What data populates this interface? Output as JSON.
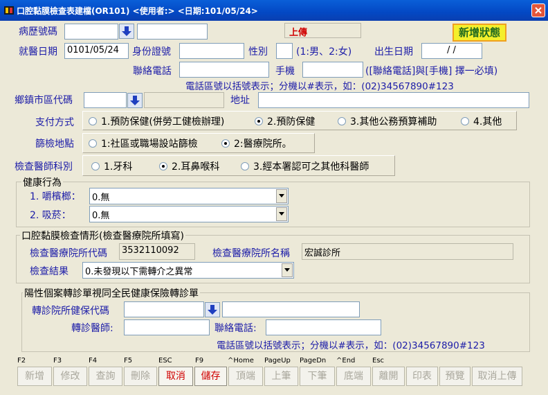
{
  "title": "口腔黏膜檢查表建檔(OR101)  <使用者:>  <日期:101/05/24>",
  "colors": {
    "title_bar": "#0348c4",
    "label": "#1c1ca8",
    "upload_red": "#d00000",
    "new_status_bg": "#f4ef2c"
  },
  "header": {
    "chart_no_label": "病歷號碼",
    "chart_no_value": "",
    "name_value": "",
    "upload_label": "上傳",
    "new_status_button": "新增狀態",
    "visit_date_label": "就醫日期",
    "visit_date_value": "0101/05/24",
    "id_label": "身份證號",
    "id_value": "",
    "gender_label": "性別",
    "gender_value": "",
    "gender_hint": "(1:男、2:女)",
    "birth_label": "出生日期",
    "birth_value": "/    /",
    "phone_label": "聯絡電話",
    "phone_value": "",
    "mobile_label": "手機",
    "mobile_value": "",
    "phone_hint": "([聯絡電話]與[手機] 擇一必填)",
    "phone_format_hint": "電話區號以括號表示；分機以#表示，如：(02)34567890#123",
    "town_code_label": "鄉鎮市區代碼",
    "town_code_value": "",
    "town_name_value": "",
    "address_label": "地址",
    "address_value": ""
  },
  "payment": {
    "label": "支付方式",
    "options": [
      "1.預防保健(併勞工健檢辦理)",
      "2.預防保健",
      "3.其他公務預算補助",
      "4.其他"
    ],
    "selected": "2.預防保健"
  },
  "screening_site": {
    "label": "篩檢地點",
    "options": [
      "1:社區或職場設站篩檢",
      "2:醫療院所。"
    ],
    "selected": "2:醫療院所。"
  },
  "specialty": {
    "label": "檢查醫師科別",
    "options": [
      "1.牙科",
      "2.耳鼻喉科",
      "3.經本署認可之其他科醫師"
    ],
    "selected": "2.耳鼻喉科"
  },
  "health": {
    "title": "健康行為",
    "betel_label": "1. 嚼檳榔：",
    "betel_value": "0.無",
    "smoking_label": "2. 吸菸：",
    "smoking_value": "0.無"
  },
  "exam": {
    "title": "口腔黏膜檢查情形(檢查醫療院所填寫)",
    "hosp_code_label": "檢查醫療院所代碼",
    "hosp_code_value": "3532110092",
    "hosp_name_label": "檢查醫療院所名稱",
    "hosp_name_value": "宏誠診所",
    "result_label": "檢查結果",
    "result_value": "0.未發現以下需轉介之異常"
  },
  "referral": {
    "title": "陽性個案轉診單視同全民健康保險轉診單",
    "hosp_code_label": "轉診院所健保代碼",
    "hosp_code_value": "",
    "hosp_name_value": "",
    "doctor_label": "轉診醫師:",
    "doctor_value": "",
    "phone_label": "聯絡電話:",
    "phone_value": "",
    "phone_format_hint": "電話區號以括號表示；分機以#表示，如：(02)34567890#123"
  },
  "toolbar": [
    {
      "key": "F2",
      "label": "新增",
      "active": false
    },
    {
      "key": "F3",
      "label": "修改",
      "active": false
    },
    {
      "key": "F4",
      "label": "查詢",
      "active": false
    },
    {
      "key": "F5",
      "label": "刪除",
      "active": false
    },
    {
      "key": "ESC",
      "label": "取消",
      "active": true
    },
    {
      "key": "F9",
      "label": "儲存",
      "active": true
    },
    {
      "key": "^Home",
      "label": "頂端",
      "active": false
    },
    {
      "key": "PageUp",
      "label": "上筆",
      "active": false
    },
    {
      "key": "PageDn",
      "label": "下筆",
      "active": false
    },
    {
      "key": "^End",
      "label": "底端",
      "active": false
    },
    {
      "key": "Esc",
      "label": "離開",
      "active": false
    },
    {
      "key": "",
      "label": "印表",
      "active": false
    },
    {
      "key": "",
      "label": "預覽",
      "active": false
    },
    {
      "key": "",
      "label": "取消上傳",
      "active": false
    }
  ]
}
